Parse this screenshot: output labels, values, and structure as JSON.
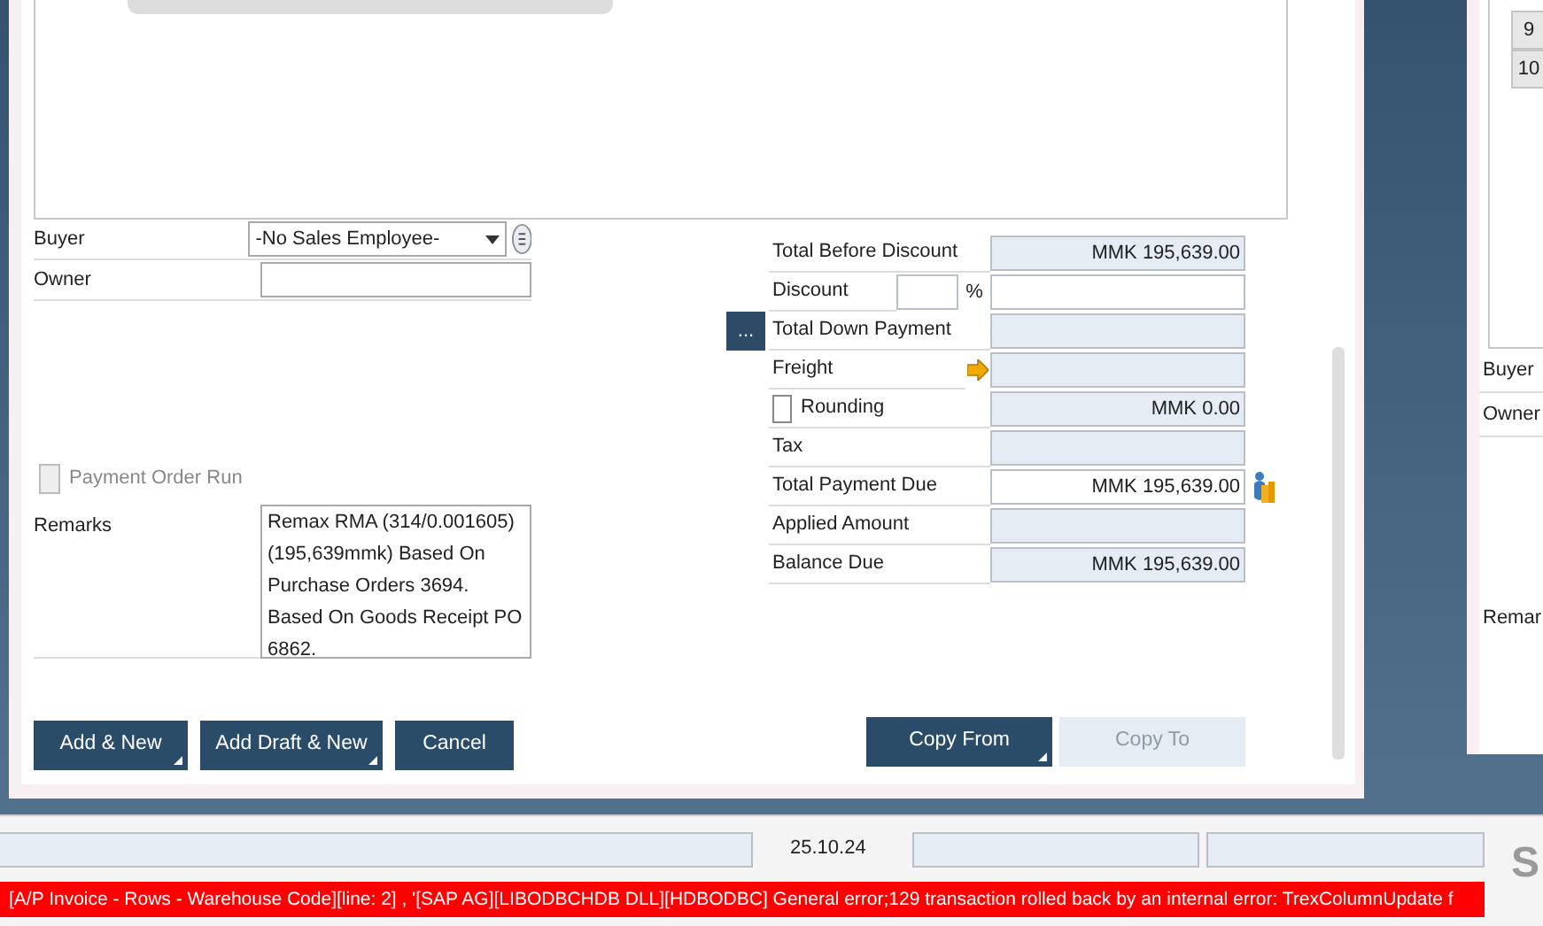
{
  "left_form": {
    "buyer": {
      "label": "Buyer",
      "value": "-No Sales Employee-"
    },
    "owner": {
      "label": "Owner"
    },
    "payment_order_run": {
      "label": "Payment Order Run",
      "checked": false,
      "disabled": true
    },
    "remarks": {
      "label": "Remarks",
      "value": "Remax RMA (314/0.001605)(195,639mmk) Based On Purchase Orders 3694. Based On Goods Receipt PO 6862."
    }
  },
  "totals": [
    {
      "kind": "plain",
      "label": "Total Before Discount",
      "value": "MMK 195,639.00",
      "editable": false
    },
    {
      "kind": "discount",
      "label": "Discount",
      "percent_sign": "%",
      "editable": true
    },
    {
      "kind": "more",
      "label": "Total Down Payment",
      "more_button": "...",
      "editable": false
    },
    {
      "kind": "arrow",
      "label": "Freight",
      "editable": false
    },
    {
      "kind": "check",
      "label": "Rounding",
      "checked": false,
      "value": "MMK 0.00",
      "editable": false
    },
    {
      "kind": "plain",
      "label": "Tax",
      "editable": false
    },
    {
      "kind": "chart",
      "label": "Total Payment Due",
      "value": "MMK 195,639.00",
      "editable": true
    },
    {
      "kind": "plain",
      "label": "Applied Amount",
      "editable": false
    },
    {
      "kind": "plain",
      "label": "Balance Due",
      "value": "MMK 195,639.00",
      "editable": false
    }
  ],
  "buttons_left": [
    {
      "label": "Add & New",
      "menu": true,
      "disabled": false
    },
    {
      "label": "Add Draft & New",
      "menu": true,
      "disabled": false
    },
    {
      "label": "Cancel",
      "menu": false,
      "disabled": false
    }
  ],
  "buttons_right": [
    {
      "label": "Copy From",
      "menu": true,
      "disabled": false
    },
    {
      "label": "Copy To",
      "menu": false,
      "disabled": true
    }
  ],
  "second_window": {
    "row_numbers": [
      "9",
      "10"
    ],
    "labels": [
      {
        "text": "Buyer"
      },
      {
        "text": "Owner"
      },
      {
        "text": "Remar"
      }
    ]
  },
  "status_bar": {
    "date": "25.10.24",
    "error": "[A/P Invoice - Rows - Warehouse Code][line: 2] , '[SAP AG][LIBODBCHDB DLL][HDBODBC] General error;129 transaction rolled back by an internal error: TrexColumnUpdate f",
    "logo_text": "S"
  }
}
